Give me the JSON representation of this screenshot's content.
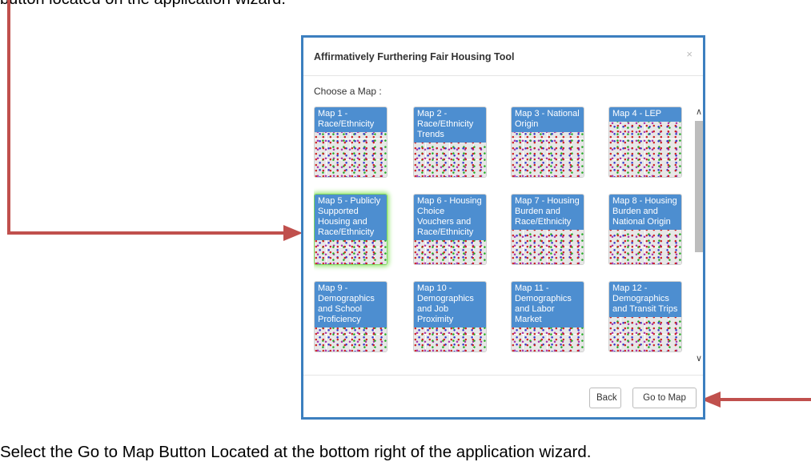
{
  "document": {
    "top_caption": "button located on the application wizard.",
    "bottom_caption": "Select the Go to Map Button Located at the bottom right of the application wizard."
  },
  "dialog": {
    "title": "Affirmatively Furthering Fair Housing Tool",
    "close_icon": "×",
    "choose_label": "Choose a Map :",
    "maps": [
      {
        "label": "Map 1 - Race/Ethnicity",
        "selected": false
      },
      {
        "label": "Map 2 - Race/Ethnicity Trends",
        "selected": false
      },
      {
        "label": "Map 3 - National Origin",
        "selected": false
      },
      {
        "label": "Map 4 - LEP",
        "selected": false
      },
      {
        "label": "Map 5 - Publicly Supported Housing and Race/Ethnicity",
        "selected": true
      },
      {
        "label": "Map 6 - Housing Choice Vouchers and Race/Ethnicity",
        "selected": false
      },
      {
        "label": "Map 7 - Housing Burden and Race/Ethnicity",
        "selected": false
      },
      {
        "label": "Map 8 - Housing Burden and National Origin",
        "selected": false
      },
      {
        "label": "Map 9 - Demographics and School Proficiency",
        "selected": false
      },
      {
        "label": "Map 10 - Demographics and Job Proximity",
        "selected": false
      },
      {
        "label": "Map 11 - Demographics and Labor Market",
        "selected": false
      },
      {
        "label": "Map 12 - Demographics and Transit Trips",
        "selected": false
      }
    ],
    "back_label": "Back",
    "go_to_map_label": "Go to Map"
  },
  "colors": {
    "accent": "#3c7fbf",
    "tile_label": "#4d8ed0",
    "arrow": "#c0504d",
    "selected_glow": "#7ed85a"
  }
}
